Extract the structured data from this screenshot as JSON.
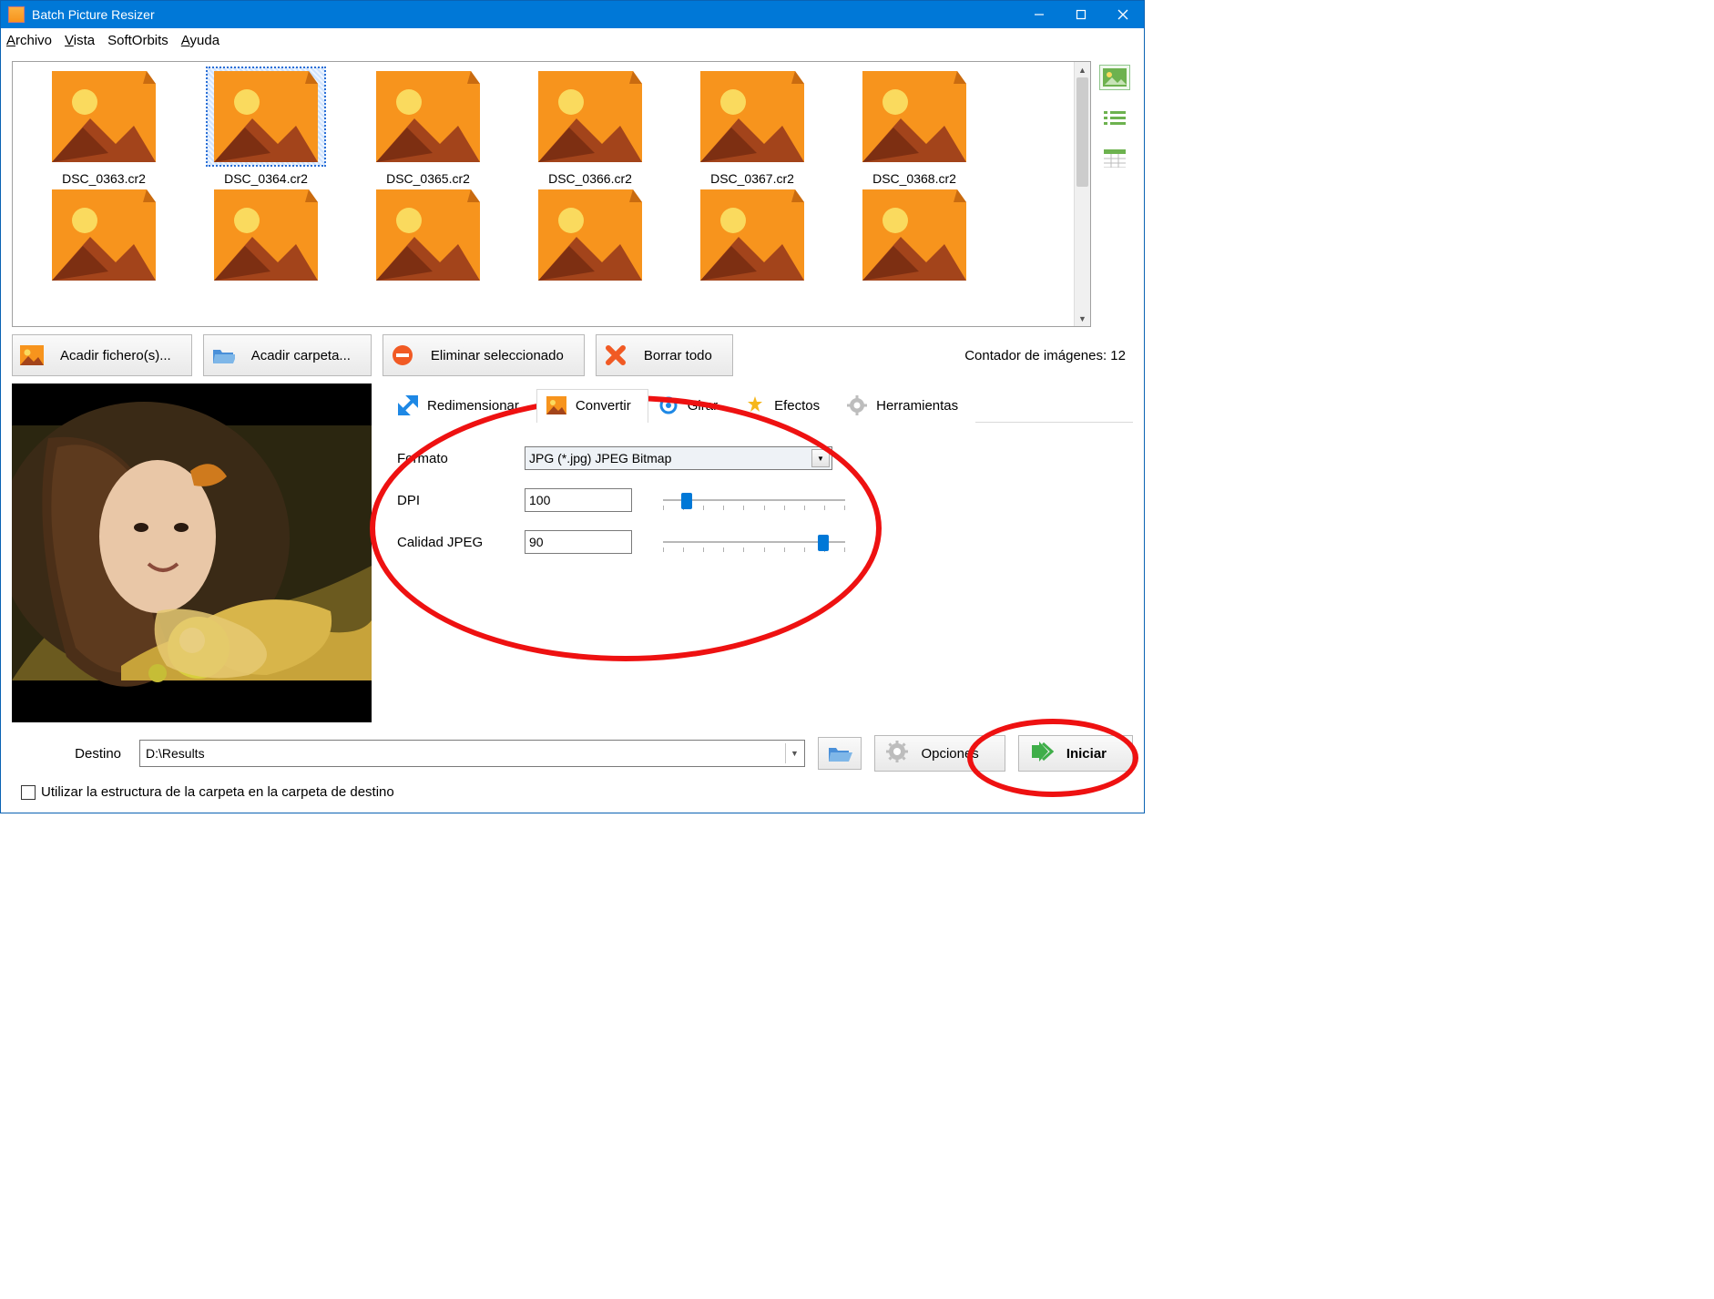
{
  "title": "Batch Picture Resizer",
  "menu": {
    "archivo": "Archivo",
    "vista": "Vista",
    "softorbits": "SoftOrbits",
    "ayuda": "Ayuda"
  },
  "thumbs": [
    "DSC_0363.cr2",
    "DSC_0364.cr2",
    "DSC_0365.cr2",
    "DSC_0366.cr2",
    "DSC_0367.cr2",
    "DSC_0368.cr2"
  ],
  "selected_index": 1,
  "toolbar": {
    "add_files": "Acadir fichero(s)...",
    "add_folder": "Acadir carpeta...",
    "remove_selected": "Eliminar seleccionado",
    "clear_all": "Borrar todo",
    "counter": "Contador de imágenes: 12"
  },
  "tabs": {
    "resize": "Redimensionar",
    "convert": "Convertir",
    "rotate": "Girar",
    "effects": "Efectos",
    "tools": "Herramientas"
  },
  "convert": {
    "format_label": "Formato",
    "format_value": "JPG (*.jpg) JPEG Bitmap",
    "dpi_label": "DPI",
    "dpi_value": "100",
    "dpi_slider_pct": 13,
    "quality_label": "Calidad JPEG",
    "quality_value": "90",
    "quality_slider_pct": 88
  },
  "footer": {
    "dest_label": "Destino",
    "dest_value": "D:\\Results",
    "options": "Opciones",
    "start": "Iniciar",
    "use_folder": "Utilizar la estructura de la carpeta en la carpeta de destino"
  }
}
